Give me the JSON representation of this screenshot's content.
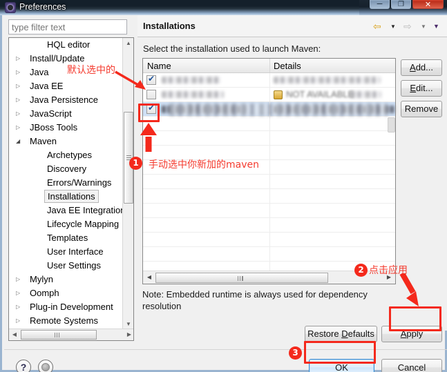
{
  "window": {
    "title": "Preferences",
    "icon": "preferences-gear-icon",
    "controls": {
      "minimize": "–",
      "maximize": "❐",
      "close": "✕"
    }
  },
  "filter": {
    "placeholder": "type filter text",
    "value": ""
  },
  "tree": {
    "items": [
      {
        "label": "HQL editor",
        "level": 1,
        "arrow": "",
        "selected": false
      },
      {
        "label": "Install/Update",
        "level": 0,
        "arrow": "▷",
        "selected": false
      },
      {
        "label": "Java",
        "level": 0,
        "arrow": "▷",
        "selected": false
      },
      {
        "label": "Java EE",
        "level": 0,
        "arrow": "▷",
        "selected": false
      },
      {
        "label": "Java Persistence",
        "level": 0,
        "arrow": "▷",
        "selected": false
      },
      {
        "label": "JavaScript",
        "level": 0,
        "arrow": "▷",
        "selected": false
      },
      {
        "label": "JBoss Tools",
        "level": 0,
        "arrow": "▷",
        "selected": false
      },
      {
        "label": "Maven",
        "level": 0,
        "arrow": "◢",
        "selected": false
      },
      {
        "label": "Archetypes",
        "level": 1,
        "arrow": "",
        "selected": false
      },
      {
        "label": "Discovery",
        "level": 1,
        "arrow": "",
        "selected": false
      },
      {
        "label": "Errors/Warnings",
        "level": 1,
        "arrow": "",
        "selected": false
      },
      {
        "label": "Installations",
        "level": 1,
        "arrow": "",
        "selected": true
      },
      {
        "label": "Java EE Integration",
        "level": 1,
        "arrow": "",
        "selected": false
      },
      {
        "label": "Lifecycle Mapping",
        "level": 1,
        "arrow": "",
        "selected": false
      },
      {
        "label": "Templates",
        "level": 1,
        "arrow": "",
        "selected": false
      },
      {
        "label": "User Interface",
        "level": 1,
        "arrow": "",
        "selected": false
      },
      {
        "label": "User Settings",
        "level": 1,
        "arrow": "",
        "selected": false
      },
      {
        "label": "Mylyn",
        "level": 0,
        "arrow": "▷",
        "selected": false
      },
      {
        "label": "Oomph",
        "level": 0,
        "arrow": "▷",
        "selected": false
      },
      {
        "label": "Plug-in Development",
        "level": 0,
        "arrow": "▷",
        "selected": false
      },
      {
        "label": "Remote Systems",
        "level": 0,
        "arrow": "▷",
        "selected": false
      }
    ],
    "scroll_up": "▲",
    "scroll_down": "▼",
    "scroll_left": "◀",
    "scroll_right": "▶"
  },
  "page": {
    "title": "Installations",
    "instruction": "Select the installation used to launch Maven:",
    "note": "Note: Embedded runtime is always used for dependency resolution",
    "nav": {
      "back": "⇦",
      "back_dropdown": "▼",
      "forward": "⇨",
      "forward_dropdown": "▼",
      "menu_dropdown": "▼"
    }
  },
  "table": {
    "columns": [
      "Name",
      "Details"
    ],
    "rows": [
      {
        "checked": true,
        "name": "",
        "details": "",
        "selected": false,
        "redacted": true,
        "not_available": false
      },
      {
        "checked": false,
        "name": "",
        "details": "NOT AVAILABLE",
        "selected": false,
        "redacted": true,
        "not_available": true
      },
      {
        "checked": true,
        "name": "",
        "details": "",
        "selected": true,
        "redacted": true,
        "not_available": false
      }
    ],
    "scroll_left": "◀",
    "scroll_right": "▶"
  },
  "buttons": {
    "add": "Add...",
    "edit": "Edit...",
    "remove": "Remove",
    "restore_defaults": "Restore Defaults",
    "apply": "Apply",
    "ok": "OK",
    "cancel": "Cancel"
  },
  "footer": {
    "help_icon": "?",
    "restore_icon": "restore-window-icon"
  },
  "annotations": {
    "default_selected": "默认选中的",
    "step1_num": "1",
    "step1_text": "手动选中你新加的maven",
    "step2_num": "2",
    "step2_text": "点击应用",
    "step3_num": "3",
    "color": "#f4291c"
  }
}
